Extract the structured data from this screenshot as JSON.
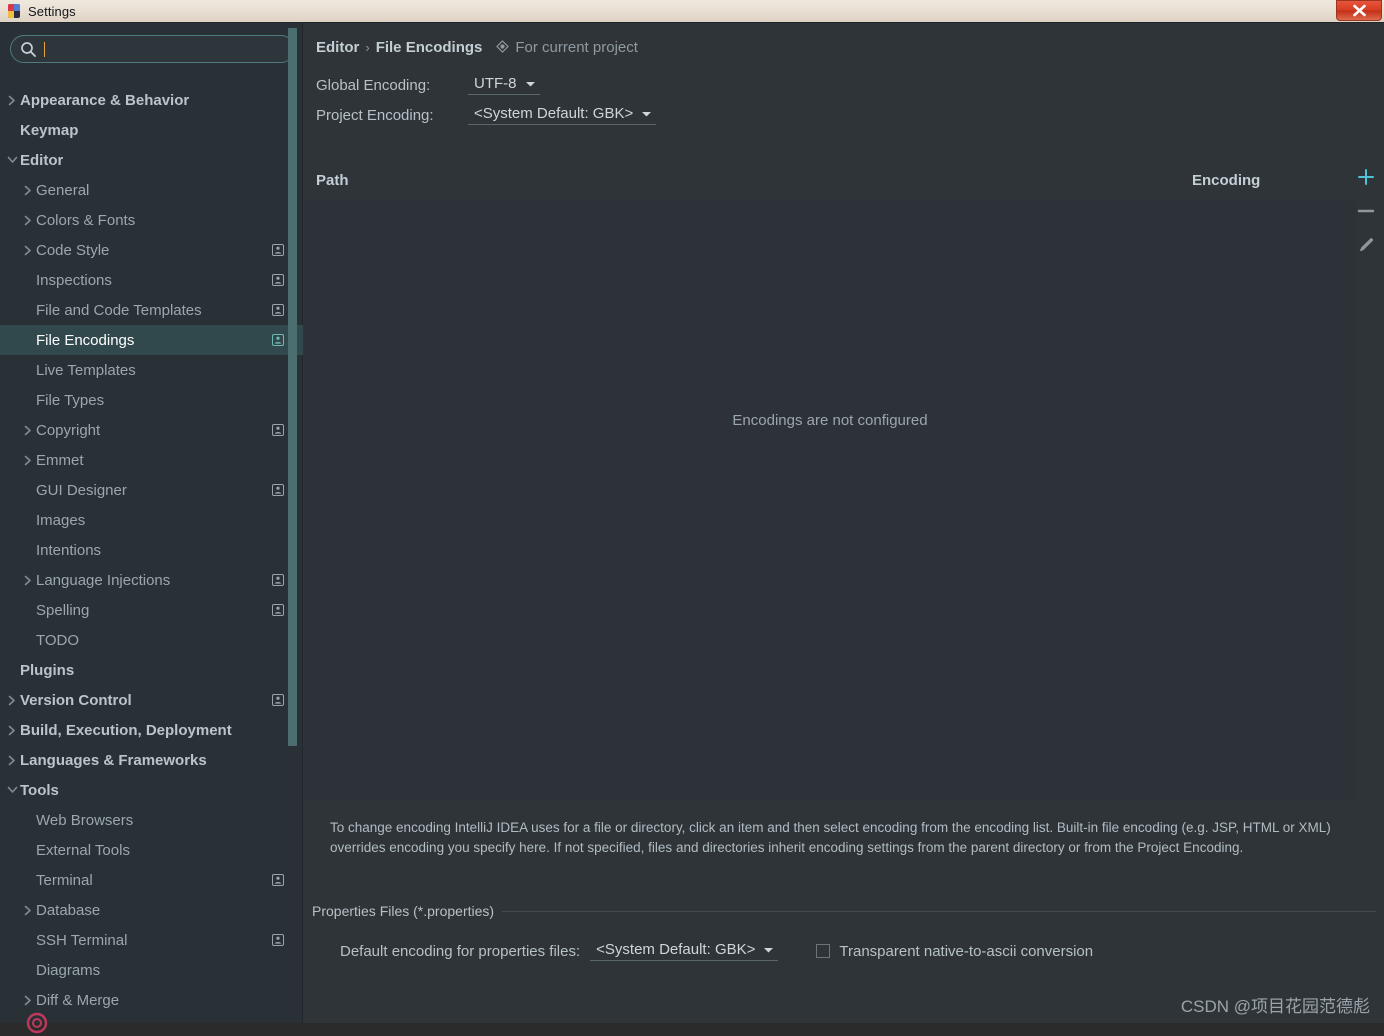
{
  "window": {
    "title": "Settings",
    "app_icon": "intellij-idea-icon",
    "close_label": "×"
  },
  "sidebar": {
    "search": {
      "value": "",
      "placeholder": "",
      "icon": "search-icon"
    },
    "items": [
      {
        "label": "Appearance & Behavior",
        "level": 0,
        "arrow": "collapsed",
        "bold": true,
        "badge": false,
        "selected": false
      },
      {
        "label": "Keymap",
        "level": 0,
        "arrow": "none",
        "bold": true,
        "badge": false,
        "selected": false
      },
      {
        "label": "Editor",
        "level": 0,
        "arrow": "expanded",
        "bold": true,
        "badge": false,
        "selected": false
      },
      {
        "label": "General",
        "level": 1,
        "arrow": "collapsed",
        "bold": false,
        "badge": false,
        "selected": false
      },
      {
        "label": "Colors & Fonts",
        "level": 1,
        "arrow": "collapsed",
        "bold": false,
        "badge": false,
        "selected": false
      },
      {
        "label": "Code Style",
        "level": 1,
        "arrow": "collapsed",
        "bold": false,
        "badge": true,
        "selected": false
      },
      {
        "label": "Inspections",
        "level": 1,
        "arrow": "none",
        "bold": false,
        "badge": true,
        "selected": false
      },
      {
        "label": "File and Code Templates",
        "level": 1,
        "arrow": "none",
        "bold": false,
        "badge": true,
        "selected": false
      },
      {
        "label": "File Encodings",
        "level": 1,
        "arrow": "none",
        "bold": false,
        "badge": true,
        "selected": true
      },
      {
        "label": "Live Templates",
        "level": 1,
        "arrow": "none",
        "bold": false,
        "badge": false,
        "selected": false
      },
      {
        "label": "File Types",
        "level": 1,
        "arrow": "none",
        "bold": false,
        "badge": false,
        "selected": false
      },
      {
        "label": "Copyright",
        "level": 1,
        "arrow": "collapsed",
        "bold": false,
        "badge": true,
        "selected": false
      },
      {
        "label": "Emmet",
        "level": 1,
        "arrow": "collapsed",
        "bold": false,
        "badge": false,
        "selected": false
      },
      {
        "label": "GUI Designer",
        "level": 1,
        "arrow": "none",
        "bold": false,
        "badge": true,
        "selected": false
      },
      {
        "label": "Images",
        "level": 1,
        "arrow": "none",
        "bold": false,
        "badge": false,
        "selected": false
      },
      {
        "label": "Intentions",
        "level": 1,
        "arrow": "none",
        "bold": false,
        "badge": false,
        "selected": false
      },
      {
        "label": "Language Injections",
        "level": 1,
        "arrow": "collapsed",
        "bold": false,
        "badge": true,
        "selected": false
      },
      {
        "label": "Spelling",
        "level": 1,
        "arrow": "none",
        "bold": false,
        "badge": true,
        "selected": false
      },
      {
        "label": "TODO",
        "level": 1,
        "arrow": "none",
        "bold": false,
        "badge": false,
        "selected": false
      },
      {
        "label": "Plugins",
        "level": 0,
        "arrow": "none",
        "bold": true,
        "badge": false,
        "selected": false
      },
      {
        "label": "Version Control",
        "level": 0,
        "arrow": "collapsed",
        "bold": true,
        "badge": true,
        "selected": false
      },
      {
        "label": "Build, Execution, Deployment",
        "level": 0,
        "arrow": "collapsed",
        "bold": true,
        "badge": false,
        "selected": false
      },
      {
        "label": "Languages & Frameworks",
        "level": 0,
        "arrow": "collapsed",
        "bold": true,
        "badge": false,
        "selected": false
      },
      {
        "label": "Tools",
        "level": 0,
        "arrow": "expanded",
        "bold": true,
        "badge": false,
        "selected": false
      },
      {
        "label": "Web Browsers",
        "level": 1,
        "arrow": "none",
        "bold": false,
        "badge": false,
        "selected": false
      },
      {
        "label": "External Tools",
        "level": 1,
        "arrow": "none",
        "bold": false,
        "badge": false,
        "selected": false
      },
      {
        "label": "Terminal",
        "level": 1,
        "arrow": "none",
        "bold": false,
        "badge": true,
        "selected": false
      },
      {
        "label": "Database",
        "level": 1,
        "arrow": "collapsed",
        "bold": false,
        "badge": false,
        "selected": false
      },
      {
        "label": "SSH Terminal",
        "level": 1,
        "arrow": "none",
        "bold": false,
        "badge": true,
        "selected": false
      },
      {
        "label": "Diagrams",
        "level": 1,
        "arrow": "none",
        "bold": false,
        "badge": false,
        "selected": false
      },
      {
        "label": "Diff & Merge",
        "level": 1,
        "arrow": "collapsed",
        "bold": false,
        "badge": false,
        "selected": false
      }
    ]
  },
  "header": {
    "breadcrumb_parent": "Editor",
    "breadcrumb_separator": "›",
    "breadcrumb_current": "File Encodings",
    "scope_icon": "scope-diamond-icon",
    "scope_text": "For current project"
  },
  "encodings": {
    "global_label": "Global Encoding:",
    "global_value": "UTF-8",
    "project_label": "Project Encoding:",
    "project_value": "<System Default: GBK>"
  },
  "table": {
    "col_path": "Path",
    "col_encoding": "Encoding",
    "empty_message": "Encodings are not configured",
    "actions": [
      {
        "name": "add-encoding-button",
        "icon": "plus-icon",
        "color": "#4fc3d4"
      },
      {
        "name": "remove-encoding-button",
        "icon": "minus-icon",
        "color": "#8d979d"
      },
      {
        "name": "edit-encoding-button",
        "icon": "pencil-icon",
        "color": "#8d979d"
      }
    ]
  },
  "hint": {
    "text": "To change encoding IntelliJ IDEA uses for a file or directory, click an item and then select encoding from the encoding list. Built-in file encoding (e.g. JSP, HTML or XML) overrides encoding you specify here. If not specified, files and directories inherit encoding settings from the parent directory or from the Project Encoding."
  },
  "properties": {
    "section_title": "Properties Files (*.properties)",
    "default_encoding_label": "Default encoding for properties files:",
    "default_encoding_value": "<System Default: GBK>",
    "native_checkbox_label": "Transparent native-to-ascii conversion",
    "native_checkbox_checked": false
  },
  "watermark": {
    "text": "CSDN @项目花园范德彪"
  },
  "colors": {
    "accent": "#4fc3d4",
    "selection": "#31484d",
    "panel_bg": "#2f3439",
    "sidebar_bg": "#2a3136",
    "titlebar_bg": "#e8dfd2",
    "close_red": "#d63c22"
  }
}
